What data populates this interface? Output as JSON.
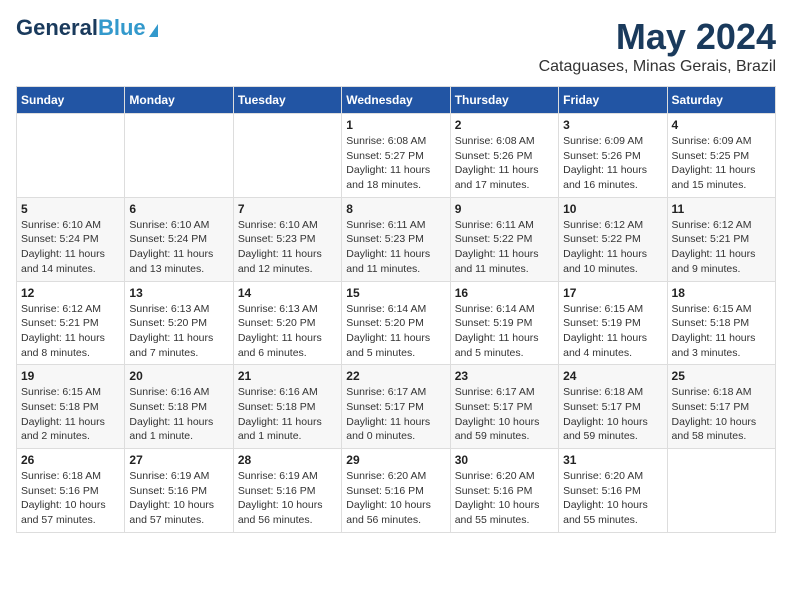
{
  "header": {
    "logo_general": "General",
    "logo_blue": "Blue",
    "month": "May 2024",
    "location": "Cataguases, Minas Gerais, Brazil"
  },
  "weekdays": [
    "Sunday",
    "Monday",
    "Tuesday",
    "Wednesday",
    "Thursday",
    "Friday",
    "Saturday"
  ],
  "weeks": [
    [
      {
        "day": "",
        "info": ""
      },
      {
        "day": "",
        "info": ""
      },
      {
        "day": "",
        "info": ""
      },
      {
        "day": "1",
        "info": "Sunrise: 6:08 AM\nSunset: 5:27 PM\nDaylight: 11 hours\nand 18 minutes."
      },
      {
        "day": "2",
        "info": "Sunrise: 6:08 AM\nSunset: 5:26 PM\nDaylight: 11 hours\nand 17 minutes."
      },
      {
        "day": "3",
        "info": "Sunrise: 6:09 AM\nSunset: 5:26 PM\nDaylight: 11 hours\nand 16 minutes."
      },
      {
        "day": "4",
        "info": "Sunrise: 6:09 AM\nSunset: 5:25 PM\nDaylight: 11 hours\nand 15 minutes."
      }
    ],
    [
      {
        "day": "5",
        "info": "Sunrise: 6:10 AM\nSunset: 5:24 PM\nDaylight: 11 hours\nand 14 minutes."
      },
      {
        "day": "6",
        "info": "Sunrise: 6:10 AM\nSunset: 5:24 PM\nDaylight: 11 hours\nand 13 minutes."
      },
      {
        "day": "7",
        "info": "Sunrise: 6:10 AM\nSunset: 5:23 PM\nDaylight: 11 hours\nand 12 minutes."
      },
      {
        "day": "8",
        "info": "Sunrise: 6:11 AM\nSunset: 5:23 PM\nDaylight: 11 hours\nand 11 minutes."
      },
      {
        "day": "9",
        "info": "Sunrise: 6:11 AM\nSunset: 5:22 PM\nDaylight: 11 hours\nand 11 minutes."
      },
      {
        "day": "10",
        "info": "Sunrise: 6:12 AM\nSunset: 5:22 PM\nDaylight: 11 hours\nand 10 minutes."
      },
      {
        "day": "11",
        "info": "Sunrise: 6:12 AM\nSunset: 5:21 PM\nDaylight: 11 hours\nand 9 minutes."
      }
    ],
    [
      {
        "day": "12",
        "info": "Sunrise: 6:12 AM\nSunset: 5:21 PM\nDaylight: 11 hours\nand 8 minutes."
      },
      {
        "day": "13",
        "info": "Sunrise: 6:13 AM\nSunset: 5:20 PM\nDaylight: 11 hours\nand 7 minutes."
      },
      {
        "day": "14",
        "info": "Sunrise: 6:13 AM\nSunset: 5:20 PM\nDaylight: 11 hours\nand 6 minutes."
      },
      {
        "day": "15",
        "info": "Sunrise: 6:14 AM\nSunset: 5:20 PM\nDaylight: 11 hours\nand 5 minutes."
      },
      {
        "day": "16",
        "info": "Sunrise: 6:14 AM\nSunset: 5:19 PM\nDaylight: 11 hours\nand 5 minutes."
      },
      {
        "day": "17",
        "info": "Sunrise: 6:15 AM\nSunset: 5:19 PM\nDaylight: 11 hours\nand 4 minutes."
      },
      {
        "day": "18",
        "info": "Sunrise: 6:15 AM\nSunset: 5:18 PM\nDaylight: 11 hours\nand 3 minutes."
      }
    ],
    [
      {
        "day": "19",
        "info": "Sunrise: 6:15 AM\nSunset: 5:18 PM\nDaylight: 11 hours\nand 2 minutes."
      },
      {
        "day": "20",
        "info": "Sunrise: 6:16 AM\nSunset: 5:18 PM\nDaylight: 11 hours\nand 1 minute."
      },
      {
        "day": "21",
        "info": "Sunrise: 6:16 AM\nSunset: 5:18 PM\nDaylight: 11 hours\nand 1 minute."
      },
      {
        "day": "22",
        "info": "Sunrise: 6:17 AM\nSunset: 5:17 PM\nDaylight: 11 hours\nand 0 minutes."
      },
      {
        "day": "23",
        "info": "Sunrise: 6:17 AM\nSunset: 5:17 PM\nDaylight: 10 hours\nand 59 minutes."
      },
      {
        "day": "24",
        "info": "Sunrise: 6:18 AM\nSunset: 5:17 PM\nDaylight: 10 hours\nand 59 minutes."
      },
      {
        "day": "25",
        "info": "Sunrise: 6:18 AM\nSunset: 5:17 PM\nDaylight: 10 hours\nand 58 minutes."
      }
    ],
    [
      {
        "day": "26",
        "info": "Sunrise: 6:18 AM\nSunset: 5:16 PM\nDaylight: 10 hours\nand 57 minutes."
      },
      {
        "day": "27",
        "info": "Sunrise: 6:19 AM\nSunset: 5:16 PM\nDaylight: 10 hours\nand 57 minutes."
      },
      {
        "day": "28",
        "info": "Sunrise: 6:19 AM\nSunset: 5:16 PM\nDaylight: 10 hours\nand 56 minutes."
      },
      {
        "day": "29",
        "info": "Sunrise: 6:20 AM\nSunset: 5:16 PM\nDaylight: 10 hours\nand 56 minutes."
      },
      {
        "day": "30",
        "info": "Sunrise: 6:20 AM\nSunset: 5:16 PM\nDaylight: 10 hours\nand 55 minutes."
      },
      {
        "day": "31",
        "info": "Sunrise: 6:20 AM\nSunset: 5:16 PM\nDaylight: 10 hours\nand 55 minutes."
      },
      {
        "day": "",
        "info": ""
      }
    ]
  ]
}
